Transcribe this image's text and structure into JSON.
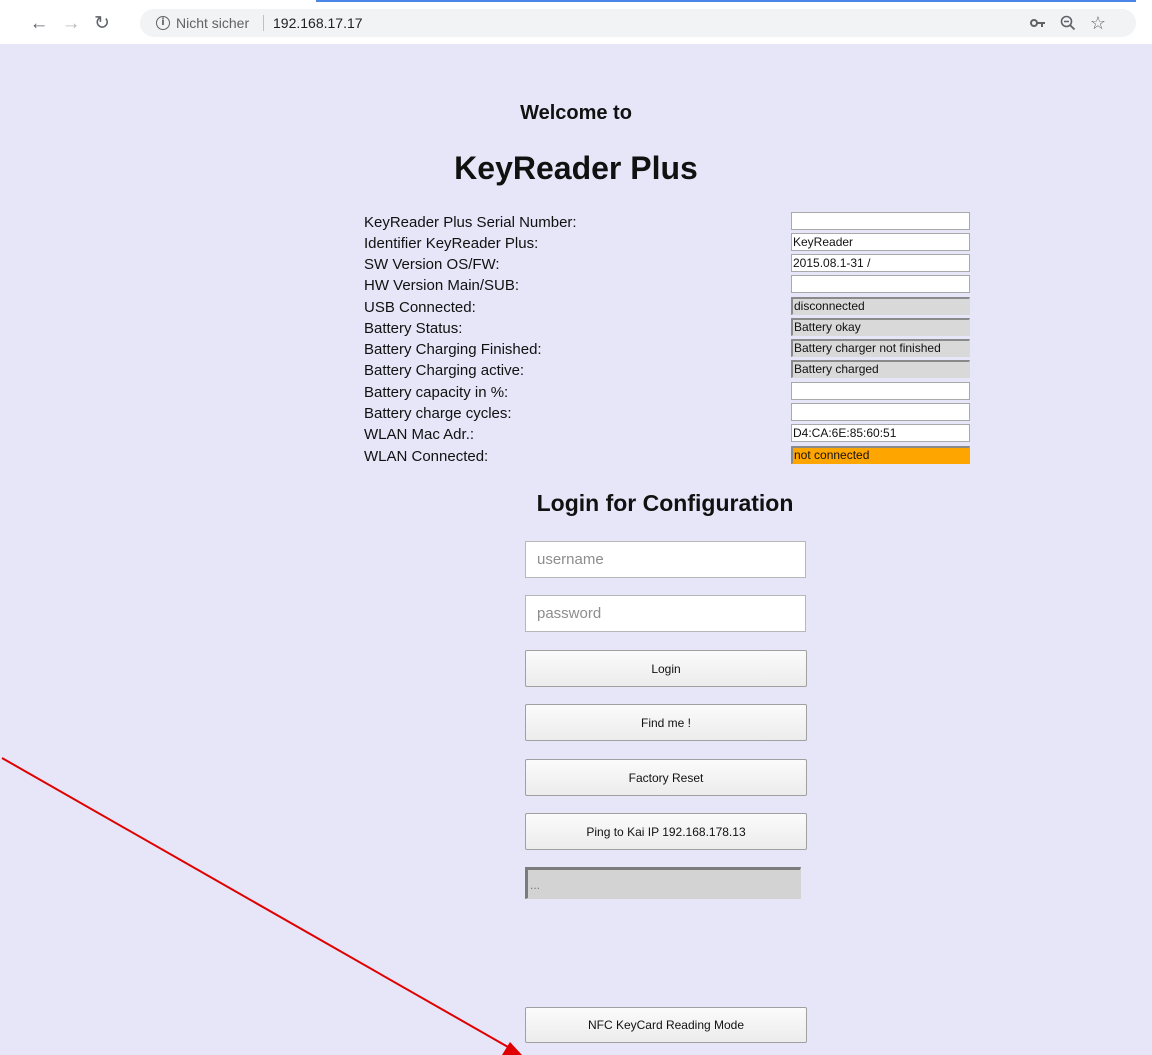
{
  "browser": {
    "back_icon": "arrow-left-icon",
    "forward_icon": "arrow-right-icon",
    "reload_icon": "reload-icon",
    "site_info_icon": "info-icon",
    "insecure_label": "Nicht sicher",
    "url": "192.168.17.17",
    "key_icon": "key-icon",
    "zoom_icon": "zoom-out-icon",
    "bookmark_icon": "star-icon"
  },
  "page": {
    "welcome": "Welcome to",
    "product": "KeyReader Plus"
  },
  "info": {
    "rows": [
      {
        "label": "KeyReader Plus Serial Number:",
        "value": ""
      },
      {
        "label": "Identifier KeyReader Plus:",
        "value": "KeyReader"
      },
      {
        "label": "SW Version OS/FW:",
        "value": "2015.08.1-31 /"
      },
      {
        "label": "HW Version Main/SUB:",
        "value": ""
      },
      {
        "label": "USB Connected:",
        "value": "disconnected"
      },
      {
        "label": "Battery Status:",
        "value": "Battery okay"
      },
      {
        "label": "Battery Charging Finished:",
        "value": "Battery charger not finished"
      },
      {
        "label": "Battery Charging active:",
        "value": "Battery charged"
      },
      {
        "label": "Battery capacity in %:",
        "value": ""
      },
      {
        "label": "Battery charge cycles:",
        "value": ""
      },
      {
        "label": "WLAN Mac Adr.:",
        "value": "D4:CA:6E:85:60:51"
      },
      {
        "label": "WLAN Connected:",
        "value": "not connected"
      }
    ]
  },
  "login": {
    "title": "Login for Configuration",
    "username_placeholder": "username",
    "password_placeholder": "password",
    "login_button": "Login",
    "find_me_button": "Find me !",
    "factory_reset_button": "Factory Reset",
    "ping_button": "Ping to Kai IP 192.168.178.13",
    "status_text": "...",
    "nfc_button": "NFC KeyCard Reading Mode"
  },
  "colors": {
    "page_background": "#e6e6f8",
    "warning": "#ffa500",
    "annotation_arrow": "#e00000"
  }
}
